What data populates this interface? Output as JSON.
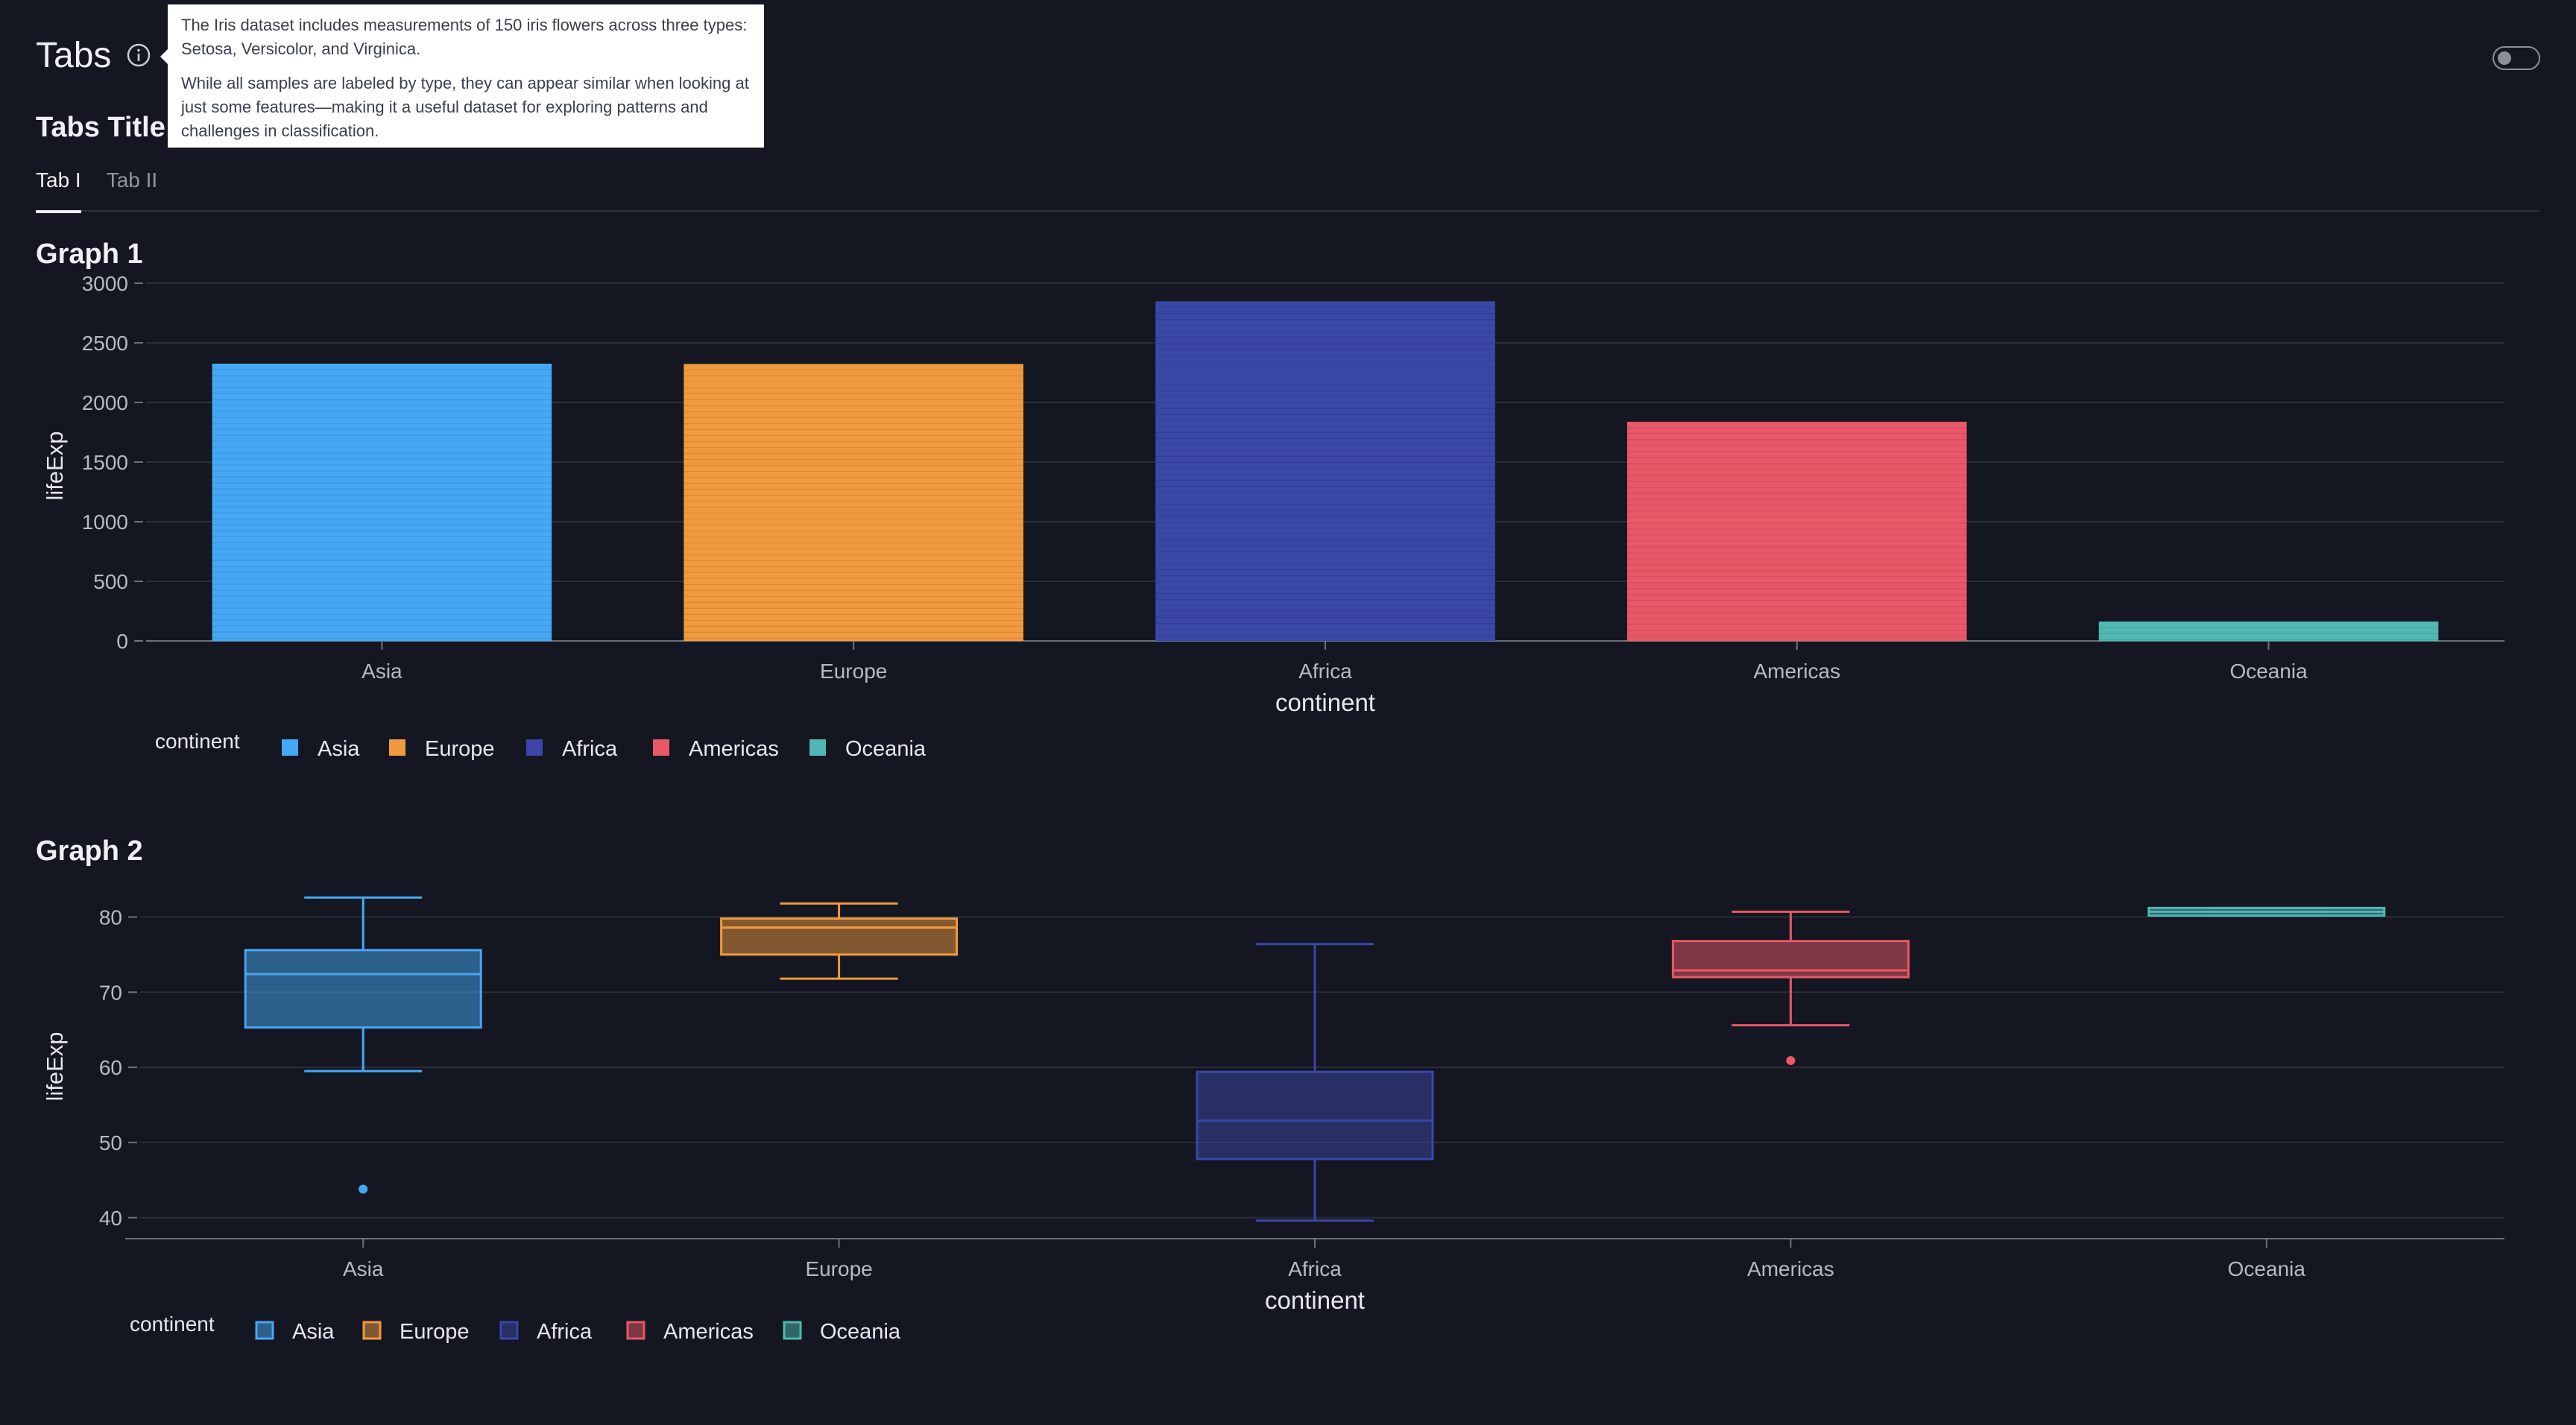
{
  "header": {
    "title": "Tabs"
  },
  "tooltip": {
    "paragraph1": "The Iris dataset includes measurements of 150 iris flowers across three types: Setosa, Versicolor, and Virginica.",
    "paragraph2": "While all samples are labeled by type, they can appear similar when looking at just some features—making it a useful dataset for exploring patterns and challenges in classification."
  },
  "section": {
    "title": "Tabs Title"
  },
  "tabs": [
    {
      "label": "Tab I",
      "active": true
    },
    {
      "label": "Tab II",
      "active": false
    }
  ],
  "colors": {
    "background": "#141721",
    "Asia": "#45a8f5",
    "Europe": "#f09a3f",
    "Africa": "#3a47a8",
    "Americas": "#e85866",
    "Oceania": "#4fb8b0"
  },
  "graph1": {
    "title": "Graph 1"
  },
  "graph2": {
    "title": "Graph 2"
  },
  "chart_data": [
    {
      "type": "bar",
      "title": "Graph 1",
      "categories": [
        "Asia",
        "Europe",
        "Africa",
        "Americas",
        "Oceania"
      ],
      "values": [
        2325,
        2323,
        2848,
        1838,
        163
      ],
      "xlabel": "continent",
      "ylabel": "lifeExp",
      "ylim": [
        0,
        3000
      ],
      "yticks": [
        0,
        500,
        1000,
        1500,
        2000,
        2500,
        3000
      ],
      "legend_title": "continent",
      "legend": [
        "Asia",
        "Europe",
        "Africa",
        "Americas",
        "Oceania"
      ],
      "legend_position": "bottom-left",
      "grid": true
    },
    {
      "type": "box",
      "title": "Graph 2",
      "categories": [
        "Asia",
        "Europe",
        "Africa",
        "Americas",
        "Oceania"
      ],
      "boxes": [
        {
          "name": "Asia",
          "min": 59.5,
          "q1": 65.3,
          "median": 72.4,
          "q3": 75.6,
          "max": 82.6,
          "outliers": [
            43.8
          ]
        },
        {
          "name": "Europe",
          "min": 71.8,
          "q1": 75.0,
          "median": 78.6,
          "q3": 79.8,
          "max": 81.8,
          "outliers": []
        },
        {
          "name": "Africa",
          "min": 39.6,
          "q1": 47.8,
          "median": 52.9,
          "q3": 59.4,
          "max": 76.4,
          "outliers": []
        },
        {
          "name": "Americas",
          "min": 65.6,
          "q1": 72.0,
          "median": 72.9,
          "q3": 76.8,
          "max": 80.7,
          "outliers": [
            60.9
          ]
        },
        {
          "name": "Oceania",
          "min": 80.2,
          "q1": 80.2,
          "median": 80.7,
          "q3": 81.2,
          "max": 81.2,
          "outliers": []
        }
      ],
      "xlabel": "continent",
      "ylabel": "lifeExp",
      "ylim": [
        37.2,
        85
      ],
      "yticks": [
        40,
        50,
        60,
        70,
        80
      ],
      "legend_title": "continent",
      "legend": [
        "Asia",
        "Europe",
        "Africa",
        "Americas",
        "Oceania"
      ],
      "legend_position": "bottom-left",
      "grid": true
    }
  ]
}
